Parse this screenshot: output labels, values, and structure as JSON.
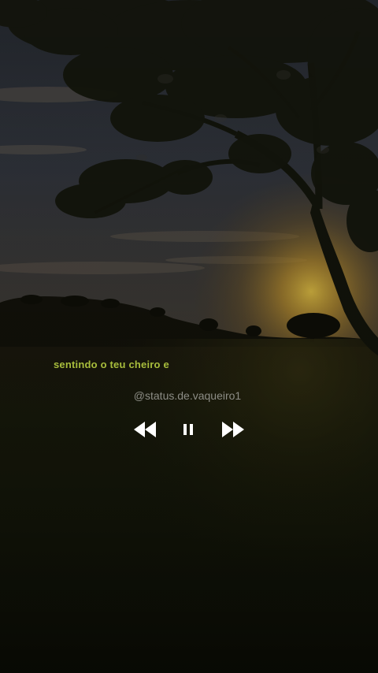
{
  "lyrics": {
    "current_line": "sentindo o teu cheiro e"
  },
  "credit": {
    "handle": "@status.de.vaqueiro1"
  },
  "player": {
    "controls": [
      {
        "icon": "rewind-icon",
        "action": "previous"
      },
      {
        "icon": "pause-icon",
        "action": "pause"
      },
      {
        "icon": "fast-forward-icon",
        "action": "next"
      }
    ],
    "icon_color": "#ffffff"
  },
  "theme": {
    "lyric_color": "#a8bd3c",
    "handle_color": "#8d8d86",
    "sun_glow": "#f2c23a",
    "sky_top": "#2b3038",
    "ground": "#14160a"
  }
}
